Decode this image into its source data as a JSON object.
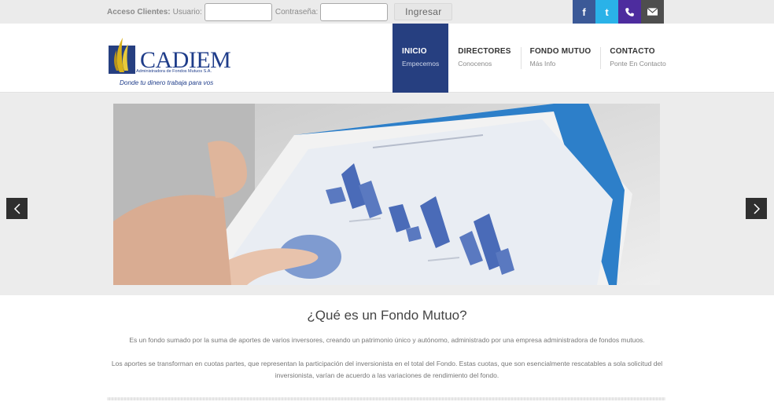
{
  "login": {
    "title": "Acceso Clientes:",
    "user_label": "Usuario:",
    "user_value": "",
    "password_label": "Contraseña:",
    "password_value": "",
    "submit_label": "Ingresar"
  },
  "social": {
    "facebook": {
      "glyph": "f",
      "icon": "facebook-icon",
      "color": "#3b5997"
    },
    "twitter": {
      "glyph": "t",
      "icon": "twitter-icon",
      "color": "#2ab2e8"
    },
    "phone": {
      "icon": "phone-icon",
      "color": "#4d2c9e"
    },
    "mail": {
      "icon": "mail-icon",
      "color": "#4e4e4e"
    }
  },
  "logo": {
    "name": "CADIEM",
    "subtitle": "Administradora de Fondos Mutuos S.A.",
    "tagline": "Donde tu dinero trabaja para vos"
  },
  "nav": [
    {
      "title": "INICIO",
      "subtitle": "Empecemos",
      "active": true
    },
    {
      "title": "DIRECTORES",
      "subtitle": "Conocenos",
      "active": false
    },
    {
      "title": "FONDO MUTUO",
      "subtitle": "Más Info",
      "active": false
    },
    {
      "title": "CONTACTO",
      "subtitle": "Ponte En Contacto",
      "active": false
    }
  ],
  "slider": {
    "prev_icon": "chevron-left-icon",
    "next_icon": "chevron-right-icon"
  },
  "section": {
    "heading": "¿Qué es un Fondo Mutuo?",
    "paragraph1": "Es un fondo sumado por la suma de aportes de varios inversores, creando un patrimonio único y autónomo, administrado por una empresa administradora de fondos mutuos.",
    "paragraph2": "Los aportes se transforman en cuotas partes, que representan la participación del inversionista en el total del Fondo. Estas cuotas, que son esencialmente rescatables a sola solicitud del inversionista, varían de acuerdo a las variaciones de rendimiento del fondo."
  },
  "colors": {
    "brand": "#263f80",
    "accent_gold": "#d9b21a"
  }
}
